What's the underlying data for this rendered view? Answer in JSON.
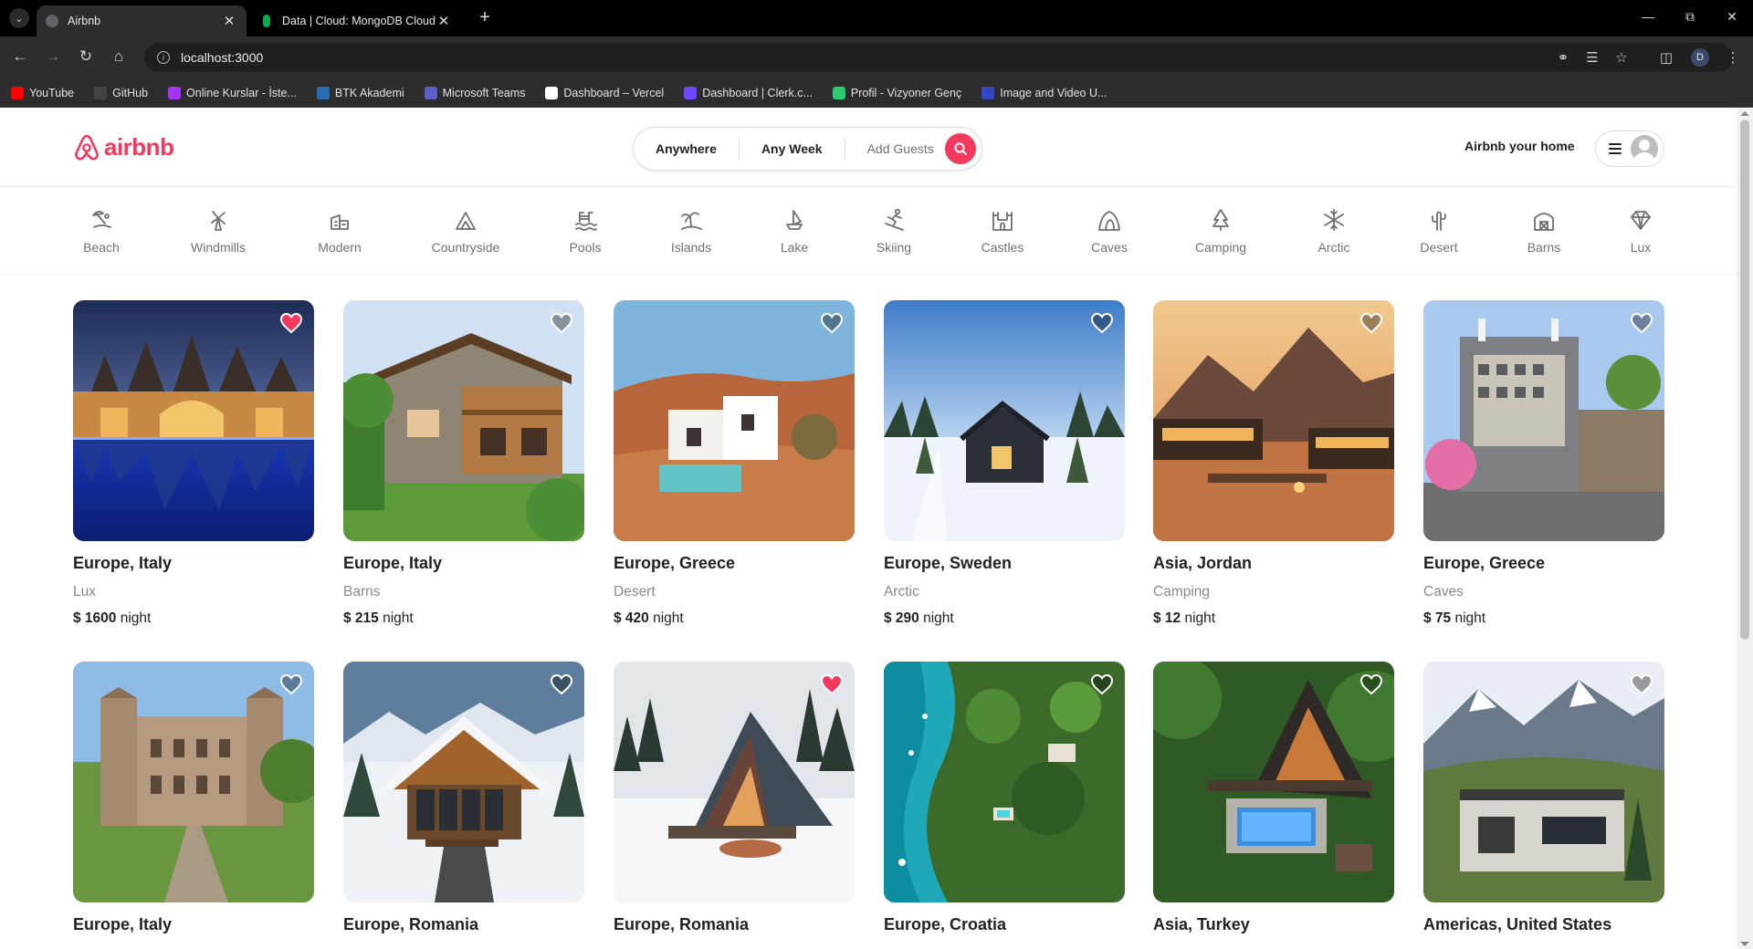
{
  "browser": {
    "tabs": [
      {
        "title": "Airbnb",
        "active": true
      },
      {
        "title": "Data | Cloud: MongoDB Cloud",
        "active": false
      }
    ],
    "url": "localhost:3000",
    "profile_initial": "D",
    "bookmarks": [
      {
        "label": "YouTube",
        "color": "#ff0000"
      },
      {
        "label": "GitHub",
        "color": "#444444"
      },
      {
        "label": "Online Kurslar - İste...",
        "color": "#a435f0"
      },
      {
        "label": "BTK Akademi",
        "color": "#2b6cb0"
      },
      {
        "label": "Microsoft Teams",
        "color": "#5b5fc7"
      },
      {
        "label": "Dashboard – Vercel",
        "color": "#ffffff"
      },
      {
        "label": "Dashboard | Clerk.c...",
        "color": "#6c47ff"
      },
      {
        "label": "Profil - Vizyoner Genç",
        "color": "#2ecc71"
      },
      {
        "label": "Image and Video U...",
        "color": "#3448c5"
      }
    ]
  },
  "header": {
    "logo_text": "airbnb",
    "search": {
      "where": "Anywhere",
      "when": "Any Week",
      "who": "Add Guests"
    },
    "host_link": "Airbnb your home"
  },
  "categories": [
    {
      "label": "Beach",
      "icon": "beach-icon"
    },
    {
      "label": "Windmills",
      "icon": "windmill-icon"
    },
    {
      "label": "Modern",
      "icon": "modern-icon"
    },
    {
      "label": "Countryside",
      "icon": "mountain-icon"
    },
    {
      "label": "Pools",
      "icon": "pool-icon"
    },
    {
      "label": "Islands",
      "icon": "island-icon"
    },
    {
      "label": "Lake",
      "icon": "boat-icon"
    },
    {
      "label": "Skiing",
      "icon": "skiing-icon"
    },
    {
      "label": "Castles",
      "icon": "castle-icon"
    },
    {
      "label": "Caves",
      "icon": "cave-icon"
    },
    {
      "label": "Camping",
      "icon": "forest-icon"
    },
    {
      "label": "Arctic",
      "icon": "snowflake-icon"
    },
    {
      "label": "Desert",
      "icon": "cactus-icon"
    },
    {
      "label": "Barns",
      "icon": "barn-icon"
    },
    {
      "label": "Lux",
      "icon": "diamond-icon"
    }
  ],
  "listings": [
    {
      "location": "Europe, Italy",
      "category": "Lux",
      "price": "$ 1600",
      "unit": "night",
      "favorite": true,
      "scene": "trulli-night"
    },
    {
      "location": "Europe, Italy",
      "category": "Barns",
      "price": "$ 215",
      "unit": "night",
      "favorite": false,
      "scene": "stone-chalet"
    },
    {
      "location": "Europe, Greece",
      "category": "Desert",
      "price": "$ 420",
      "unit": "night",
      "favorite": false,
      "scene": "desert-villa"
    },
    {
      "location": "Europe, Sweden",
      "category": "Arctic",
      "price": "$ 290",
      "unit": "night",
      "favorite": false,
      "scene": "snow-cabin"
    },
    {
      "location": "Asia, Jordan",
      "category": "Camping",
      "price": "$ 12",
      "unit": "night",
      "favorite": false,
      "scene": "desert-camp"
    },
    {
      "location": "Europe, Greece",
      "category": "Caves",
      "price": "$ 75",
      "unit": "night",
      "favorite": false,
      "scene": "stone-house"
    },
    {
      "location": "Europe, Italy",
      "category": "",
      "price": "",
      "unit": "",
      "favorite": false,
      "scene": "castle"
    },
    {
      "location": "Europe, Romania",
      "category": "",
      "price": "",
      "unit": "",
      "favorite": false,
      "scene": "snow-chalet"
    },
    {
      "location": "Europe, Romania",
      "category": "",
      "price": "",
      "unit": "",
      "favorite": true,
      "scene": "aframe-snow"
    },
    {
      "location": "Europe, Croatia",
      "category": "",
      "price": "",
      "unit": "",
      "favorite": false,
      "scene": "coast-aerial"
    },
    {
      "location": "Asia, Turkey",
      "category": "",
      "price": "",
      "unit": "",
      "favorite": false,
      "scene": "aframe-pool"
    },
    {
      "location": "Americas, United States",
      "category": "",
      "price": "",
      "unit": "",
      "favorite": false,
      "scene": "mountain-modern"
    }
  ],
  "colors": {
    "brand": "#F5385D",
    "heart_on": "#F5385D"
  }
}
